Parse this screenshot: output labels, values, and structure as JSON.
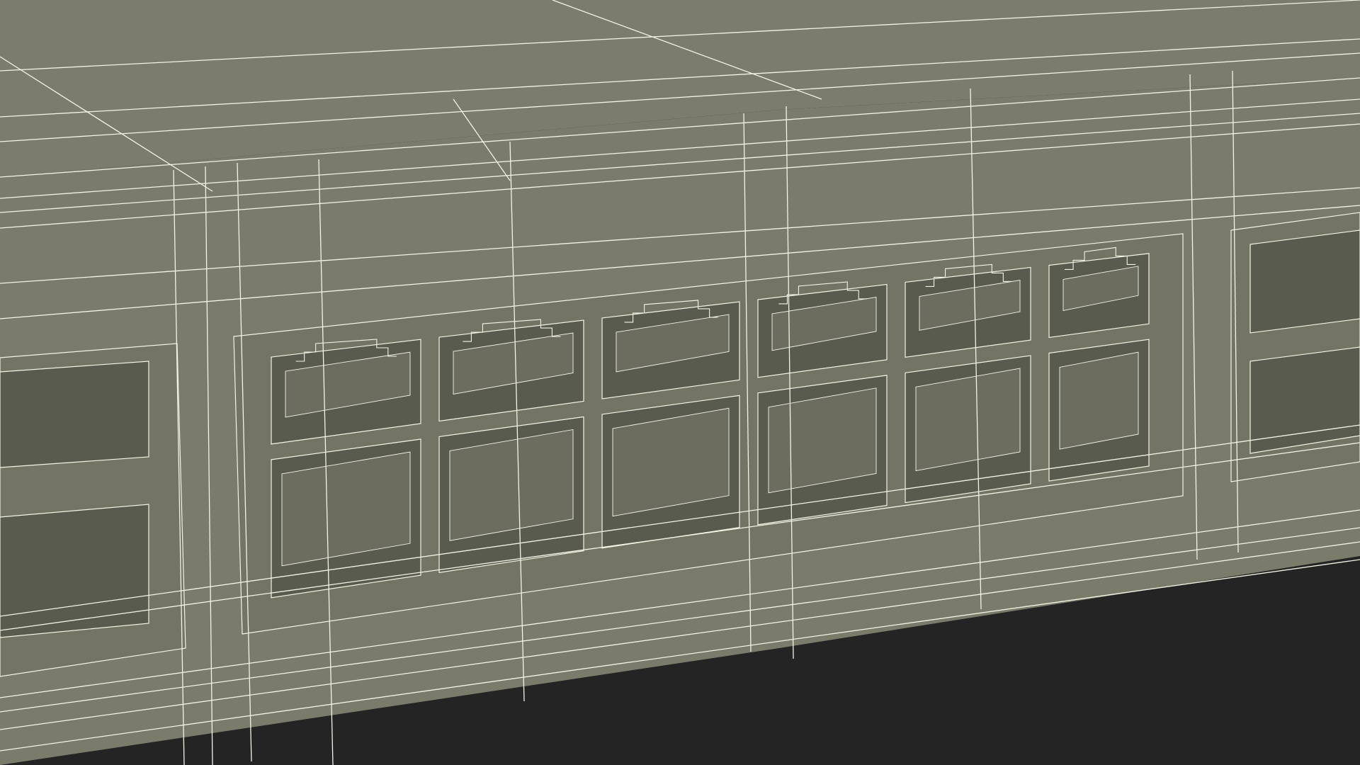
{
  "colors": {
    "background": "#242424",
    "body_top": "#7b7c6b",
    "body_front": "#7a7b6a",
    "bezel": "#737464",
    "port_cavity": "#5a5b4f",
    "port_back": "#6c6d5f",
    "wire": "#f3f3e6"
  },
  "render_style": "wireframe-over-shaded",
  "subject": {
    "port_groups": [
      {
        "rows": 2,
        "columns_visible": 1,
        "cut_off": "left"
      },
      {
        "rows": 2,
        "columns_visible": 6,
        "cut_off": "none"
      },
      {
        "rows": 2,
        "columns_visible": 1,
        "cut_off": "right"
      }
    ]
  }
}
